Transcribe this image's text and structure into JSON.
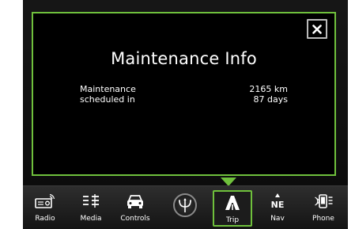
{
  "popup": {
    "title": "Maintenance Info",
    "label_line1": "Maintenance",
    "label_line2": "scheduled in",
    "value_distance": "2165 km",
    "value_days": "87 days",
    "close_icon": "close-icon",
    "accent_color": "#6fc03c"
  },
  "nav": {
    "items": [
      {
        "label": "Radio",
        "icon": "radio-icon"
      },
      {
        "label": "Media",
        "icon": "media-icon"
      },
      {
        "label": "Controls",
        "icon": "car-icon"
      },
      {
        "label": "",
        "icon": "trident-logo-icon"
      },
      {
        "label": "Trip",
        "icon": "road-icon",
        "active": true
      },
      {
        "label": "Nav",
        "icon": "compass-icon",
        "heading": "NE"
      },
      {
        "label": "Phone",
        "icon": "phone-icon"
      }
    ]
  }
}
